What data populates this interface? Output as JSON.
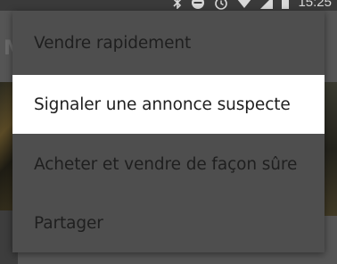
{
  "status_bar": {
    "time": "15:25",
    "icons": [
      "bluetooth-icon",
      "dnd-icon",
      "alarm-icon",
      "wifi-icon",
      "signal-icon",
      "battery-icon"
    ]
  },
  "background": {
    "title": "M"
  },
  "menu": {
    "items": [
      {
        "label": "Vendre rapidement",
        "highlighted": false
      },
      {
        "label": "Signaler une annonce suspecte",
        "highlighted": true
      },
      {
        "label": "Acheter et vendre de façon sûre",
        "highlighted": false
      },
      {
        "label": "Partager",
        "highlighted": false
      }
    ]
  },
  "colors": {
    "highlight": "#ffffff",
    "menu_background": "#4e4e4e",
    "text": "#1f1f1f"
  }
}
